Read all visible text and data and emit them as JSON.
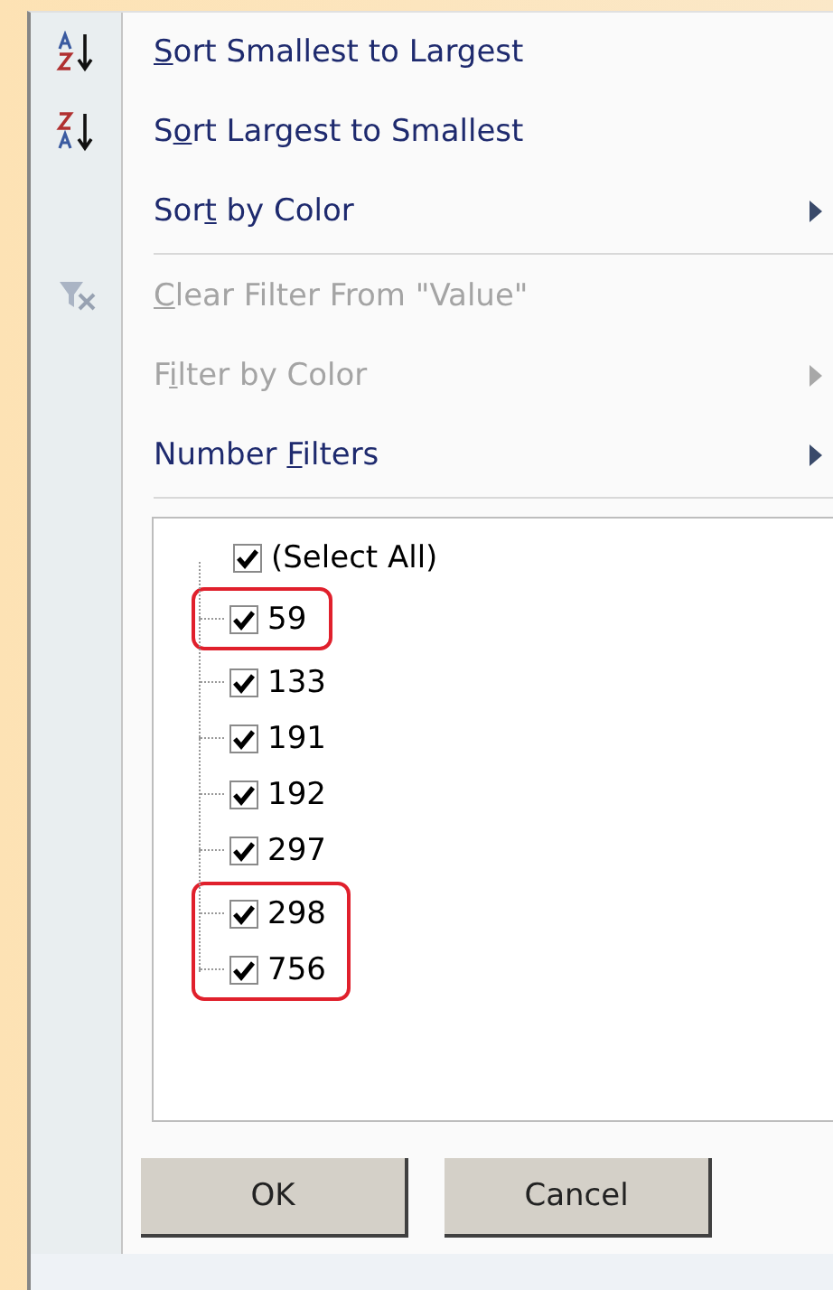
{
  "menu": [
    {
      "kind": "sort_ascending",
      "access_key": "S",
      "label_after_key": "ort Smallest to Largest",
      "disabled": false,
      "submenu": false
    },
    {
      "kind": "sort_descending",
      "label_before_key": "S",
      "access_key": "o",
      "label_after_key": "rt Largest to Smallest",
      "disabled": false,
      "submenu": false
    },
    {
      "kind": "plain",
      "label_before_key": "Sor",
      "access_key": "t",
      "label_after_key": " by Color",
      "disabled": false,
      "submenu": true
    },
    {
      "kind": "separator"
    },
    {
      "kind": "clear_filter",
      "access_key": "C",
      "label_after_key": "lear Filter From \"Value\"",
      "disabled": true,
      "submenu": false
    },
    {
      "kind": "plain",
      "label_before_key": "F",
      "access_key": "i",
      "label_after_key": "lter by Color",
      "disabled": true,
      "submenu": true
    },
    {
      "kind": "plain",
      "label_before_key": "Number ",
      "access_key": "F",
      "label_after_key": "ilters",
      "disabled": false,
      "submenu": true
    },
    {
      "kind": "separator"
    }
  ],
  "values": [
    {
      "label": "(Select All)",
      "checked": true,
      "children": [
        {
          "label": "59",
          "checked": true,
          "highlighted": true
        },
        {
          "label": "133",
          "checked": true,
          "highlighted": false
        },
        {
          "label": "191",
          "checked": true,
          "highlighted": false
        },
        {
          "label": "192",
          "checked": true,
          "highlighted": false
        },
        {
          "label": "297",
          "checked": true,
          "highlighted": false
        },
        {
          "label": "298",
          "checked": true,
          "highlighted": true
        },
        {
          "label": "756",
          "checked": true,
          "highlighted": true
        }
      ]
    }
  ],
  "buttons": [
    "OK",
    "Cancel"
  ]
}
